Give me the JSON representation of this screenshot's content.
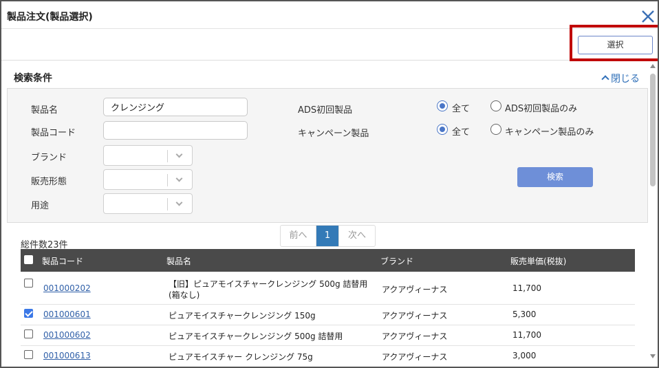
{
  "window": {
    "title": "製品注文(製品選択)"
  },
  "actions": {
    "select_label": "選択"
  },
  "search": {
    "title": "検索条件",
    "collapse_label": "閉じる",
    "product_name_label": "製品名",
    "product_name_value": "クレンジング",
    "product_code_label": "製品コード",
    "product_code_value": "",
    "brand_label": "ブランド",
    "sales_form_label": "販売形態",
    "usage_label": "用途",
    "ads_label": "ADS初回製品",
    "ads_all": "全て",
    "ads_only": "ADS初回製品のみ",
    "campaign_label": "キャンペーン製品",
    "campaign_all": "全て",
    "campaign_only": "キャンペーン製品のみ",
    "search_button": "検索"
  },
  "pager": {
    "prev": "前へ",
    "current": "1",
    "next": "次へ"
  },
  "results": {
    "total": "総件数23件",
    "columns": [
      "製品コード",
      "製品名",
      "ブランド",
      "販売単価(税抜)"
    ],
    "rows": [
      {
        "checked": false,
        "code": "001000202",
        "name": "【旧】ピュアモイスチャークレンジング 500g 詰替用(箱なし)",
        "brand": "アクアヴィーナス",
        "price": "11,700"
      },
      {
        "checked": true,
        "code": "001000601",
        "name": "ピュアモイスチャークレンジング 150g",
        "brand": "アクアヴィーナス",
        "price": "5,300"
      },
      {
        "checked": false,
        "code": "001000602",
        "name": "ピュアモイスチャークレンジング 500g 詰替用",
        "brand": "アクアヴィーナス",
        "price": "11,700"
      },
      {
        "checked": false,
        "code": "001000613",
        "name": "ピュアモイスチャー クレンジング 75g",
        "brand": "アクアヴィーナス",
        "price": "3,000"
      }
    ]
  }
}
